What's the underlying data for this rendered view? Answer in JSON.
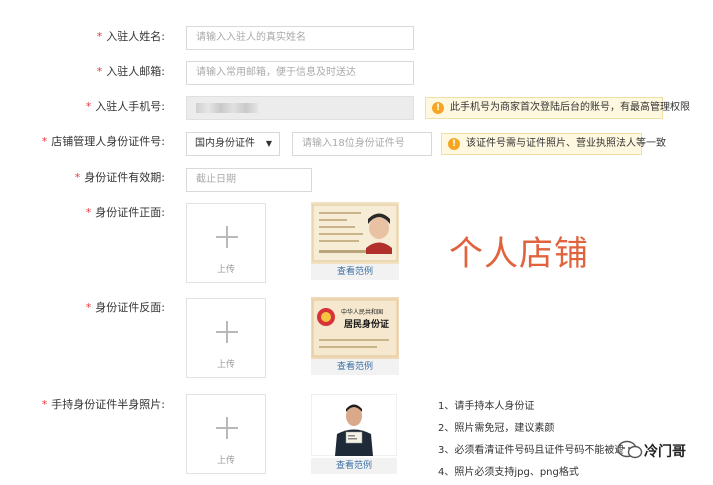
{
  "form": {
    "name": {
      "label": "入驻人姓名:",
      "placeholder": "请输入入驻人的真实姓名"
    },
    "email": {
      "label": "入驻人邮箱:",
      "placeholder": "请输入常用邮箱，便于信息及时送达"
    },
    "phone": {
      "label": "入驻人手机号:",
      "tip": "此手机号为商家首次登陆后台的账号，有最高管理权限"
    },
    "id_number": {
      "label": "店铺管理人身份证件号:",
      "type_selected": "国内身份证件",
      "placeholder": "请输入18位身份证件号",
      "tip": "该证件号需与证件照片、营业执照法人等一致"
    },
    "id_expiry": {
      "label": "身份证件有效期:",
      "placeholder": "截止日期"
    },
    "id_front": {
      "label": "身份证件正面:",
      "upload_text": "上传",
      "example_caption": "查看范例"
    },
    "id_back": {
      "label": "身份证件反面:",
      "upload_text": "上传",
      "example_caption": "查看范例"
    },
    "id_half": {
      "label": "手持身份证件半身照片:",
      "upload_text": "上传",
      "example_caption": "查看范例"
    },
    "required_mark": "*"
  },
  "overlay_title": "个人店铺",
  "requirements": [
    "1、请手持本人身份证",
    "2、照片需免冠，建议素颜",
    "3、必须看清证件号码且证件号码不能被遮挡",
    "4、照片必须支持jpg、png格式"
  ],
  "card_front": {
    "name_value": "张林宁",
    "address_label": "住址"
  },
  "card_back": {
    "country": "中华人民共和国",
    "title": "居民身份证"
  },
  "watermark": "冷门哥",
  "colors": {
    "required": "#e4393c",
    "tip_bg": "#fff8e1",
    "tip_icon": "#f6a623",
    "link": "#3a6ea5",
    "overlay_text": "#e0633d"
  }
}
